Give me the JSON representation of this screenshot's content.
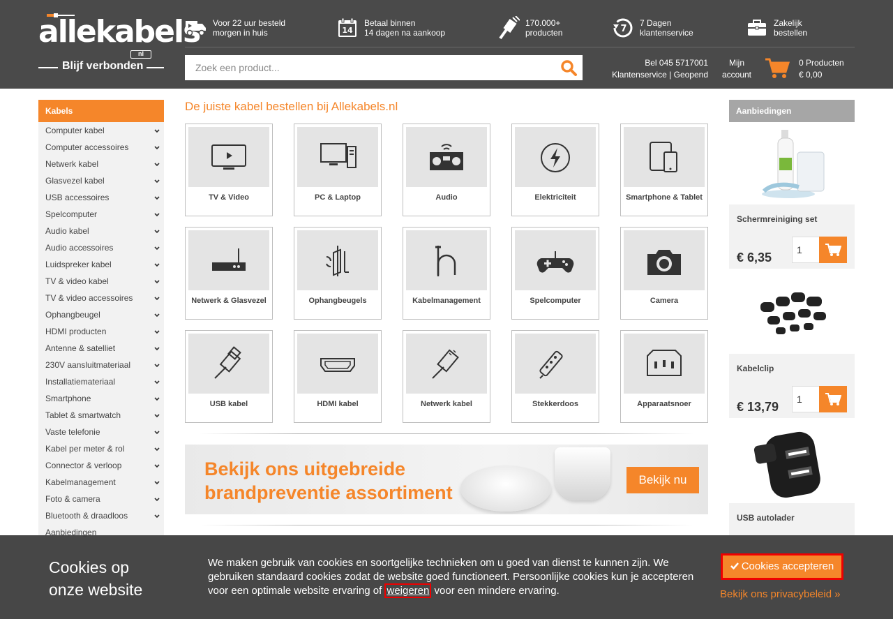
{
  "header": {
    "logo": {
      "name": "allekabels",
      "badge": "nl",
      "slogan": "Blijf verbonden"
    },
    "usps": [
      {
        "icon": "truck-icon",
        "line1": "Voor 22 uur besteld",
        "line2": "morgen in huis"
      },
      {
        "icon": "calendar-icon",
        "line1": "Betaal binnen",
        "line2": "14 dagen na aankoop"
      },
      {
        "icon": "cable-plug-icon",
        "line1": "170.000+",
        "line2": "producten"
      },
      {
        "icon": "seven-days-icon",
        "line1": "7 Dagen",
        "line2": "klantenservice"
      },
      {
        "icon": "briefcase-icon",
        "line1": "Zakelijk",
        "line2": "bestellen"
      }
    ],
    "search": {
      "placeholder": "Zoek een product..."
    },
    "contact": {
      "phone": "Bel 045 5717001",
      "status": "Klantenservice | Geopend"
    },
    "account": {
      "line1": "Mijn",
      "line2": "account"
    },
    "cart": {
      "count": "0 Producten",
      "total": "€ 0,00"
    }
  },
  "sidebar": {
    "title": "Kabels",
    "items": [
      "Computer kabel",
      "Computer accessoires",
      "Netwerk kabel",
      "Glasvezel kabel",
      "USB accessoires",
      "Spelcomputer",
      "Audio kabel",
      "Audio accessoires",
      "Luidspreker kabel",
      "TV & video kabel",
      "TV & video accessoires",
      "Ophangbeugel",
      "HDMI producten",
      "Antenne & satelliet",
      "230V aansluitmateriaal",
      "Installatiemateriaal",
      "Smartphone",
      "Tablet & smartwatch",
      "Vaste telefonie",
      "Kabel per meter & rol",
      "Connector & verloop",
      "Kabelmanagement",
      "Foto & camera",
      "Bluetooth & draadloos",
      "Aanbiedingen"
    ]
  },
  "main": {
    "title": "De juiste kabel bestellen bij Allekabels.nl",
    "categories": [
      {
        "label": "TV & Video",
        "icon": "tv-icon"
      },
      {
        "label": "PC & Laptop",
        "icon": "pc-icon"
      },
      {
        "label": "Audio",
        "icon": "radio-icon"
      },
      {
        "label": "Elektriciteit",
        "icon": "lightning-icon"
      },
      {
        "label": "Smartphone & Tablet",
        "icon": "tablet-icon"
      },
      {
        "label": "Netwerk & Glasvezel",
        "icon": "router-icon"
      },
      {
        "label": "Ophangbeugels",
        "icon": "wall-mount-icon"
      },
      {
        "label": "Kabelmanagement",
        "icon": "cable-hook-icon"
      },
      {
        "label": "Spelcomputer",
        "icon": "gamepad-icon"
      },
      {
        "label": "Camera",
        "icon": "camera-icon"
      },
      {
        "label": "USB kabel",
        "icon": "usb-plug-icon"
      },
      {
        "label": "HDMI kabel",
        "icon": "hdmi-port-icon"
      },
      {
        "label": "Netwerk kabel",
        "icon": "rj45-plug-icon"
      },
      {
        "label": "Stekkerdoos",
        "icon": "power-strip-icon"
      },
      {
        "label": "Apparaatsnoer",
        "icon": "iec-socket-icon"
      }
    ],
    "banner": {
      "line1": "Bekijk ons uitgebreide",
      "line2": "brandpreventie assortiment",
      "button": "Bekijk nu"
    }
  },
  "offers": {
    "title": "Aanbiedingen",
    "items": [
      {
        "name": "Schermreiniging set",
        "price": "€ 6,35",
        "qty": "1"
      },
      {
        "name": "Kabelclip",
        "price": "€ 13,79",
        "qty": "1"
      },
      {
        "name": "USB autolader",
        "price": "",
        "qty": ""
      }
    ]
  },
  "cookie": {
    "title_line1": "Cookies op",
    "title_line2": "onze website",
    "text_before": "We maken gebruik van cookies en soortgelijke technieken om u goed van dienst te kunnen zijn. We gebruiken standaard cookies zodat de website goed functioneert. Persoonlijke cookies kun je accepteren voor een optimale website ervaring of ",
    "refuse": "weigeren",
    "text_after": " voor een mindere ervaring.",
    "accept": "Cookies accepteren",
    "privacy": "Bekijk ons privacybeleid »"
  },
  "colors": {
    "accent": "#f5862a",
    "header_bg": "#4a4a4a",
    "highlight": "#e00000"
  }
}
